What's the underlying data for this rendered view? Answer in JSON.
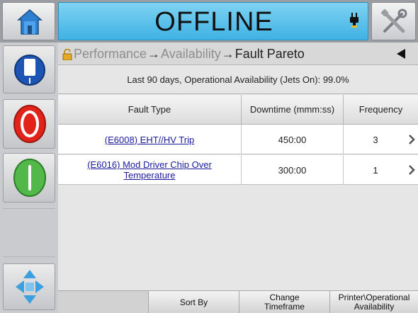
{
  "header": {
    "status": "OFFLINE",
    "status_color": "#3fb2e4"
  },
  "icons": {
    "home": "home-icon",
    "plug": "plug-icon",
    "tools": "tools-icon",
    "info": "printer-info-icon",
    "stop": "stop-icon",
    "start": "start-icon",
    "nav": "navigation-arrows-icon"
  },
  "breadcrumb": {
    "items": [
      "Performance",
      "Availability"
    ],
    "separator": "→",
    "current": "Fault Pareto"
  },
  "summary": "Last 90 days, Operational Availability (Jets On): 99.0%",
  "table": {
    "headers": [
      "Fault Type",
      "Downtime (mmm:ss)",
      "Frequency"
    ],
    "rows": [
      {
        "fault": "(E6008) EHT//HV Trip",
        "downtime": "450:00",
        "frequency": "3"
      },
      {
        "fault": "(E6016) Mod Driver Chip Over Temperature",
        "downtime": "300:00",
        "frequency": "1"
      }
    ]
  },
  "bottom_buttons": {
    "sort": "Sort By",
    "timeframe": "Change Timeframe",
    "printer_availability": "Printer\\Operational Availability"
  }
}
